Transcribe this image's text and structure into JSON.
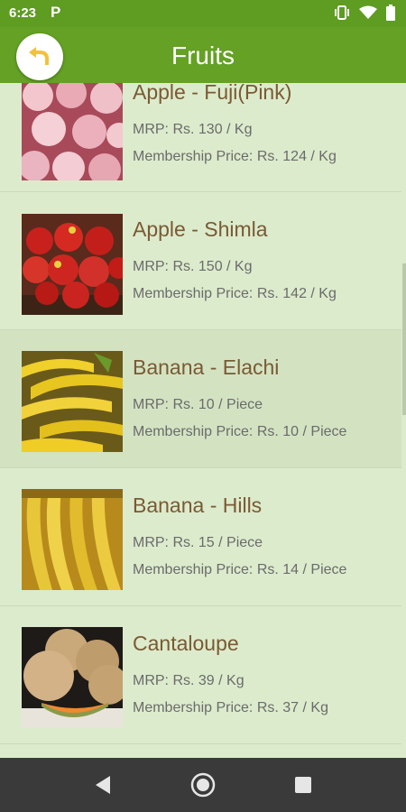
{
  "status_bar": {
    "time": "6:23",
    "app_indicator": "P"
  },
  "app_bar": {
    "title": "Fruits",
    "back_icon": "arrow-back-icon"
  },
  "products": [
    {
      "name": "Apple - Fuji(Pink)",
      "mrp": "MRP: Rs. 130 / Kg",
      "membership": "Membership Price: Rs. 124 / Kg",
      "image": "apple-fuji"
    },
    {
      "name": "Apple - Shimla",
      "mrp": "MRP: Rs. 150 / Kg",
      "membership": "Membership Price: Rs. 142 / Kg",
      "image": "apple-shimla"
    },
    {
      "name": "Banana - Elachi",
      "mrp": "MRP: Rs. 10 / Piece",
      "membership": "Membership Price: Rs. 10 / Piece",
      "image": "banana-elachi"
    },
    {
      "name": "Banana - Hills",
      "mrp": "MRP: Rs. 15 / Piece",
      "membership": "Membership Price: Rs. 14 / Piece",
      "image": "banana-hills"
    },
    {
      "name": "Cantaloupe",
      "mrp": "MRP: Rs. 39 / Kg",
      "membership": "Membership Price: Rs. 37 / Kg",
      "image": "cantaloupe"
    }
  ],
  "colors": {
    "status_bar": "#5e9c22",
    "app_bar": "#64a124",
    "background": "#dcebcc",
    "product_name": "#7a5a34"
  }
}
